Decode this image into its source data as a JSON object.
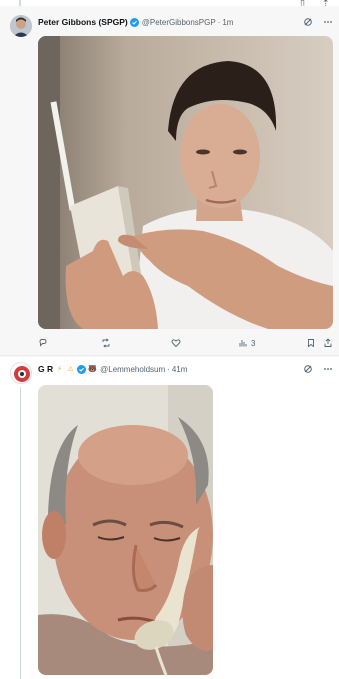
{
  "tweets": [
    {
      "display_name": "Peter Gibbons (SPGP)",
      "handle": "@PeterGibbonsPGP",
      "separator": "·",
      "time": "1m",
      "stats": {
        "reply": "",
        "retweet": "",
        "like": "",
        "views": "3"
      },
      "icons": {
        "grok": "grok-icon",
        "more": "more-icon",
        "verified": "verified-badge-icon"
      }
    },
    {
      "display_name": "G R",
      "handle": "@Lemmeholdsum",
      "separator": "·",
      "time": "41m",
      "badges": [
        "⚡",
        "⚠",
        "🐻"
      ],
      "icons": {
        "grok": "grok-icon",
        "more": "more-icon",
        "verified": "verified-badge-icon"
      }
    }
  ],
  "colors": {
    "accent": "#1d9bf0",
    "muted": "#536471",
    "text": "#0f1419"
  }
}
